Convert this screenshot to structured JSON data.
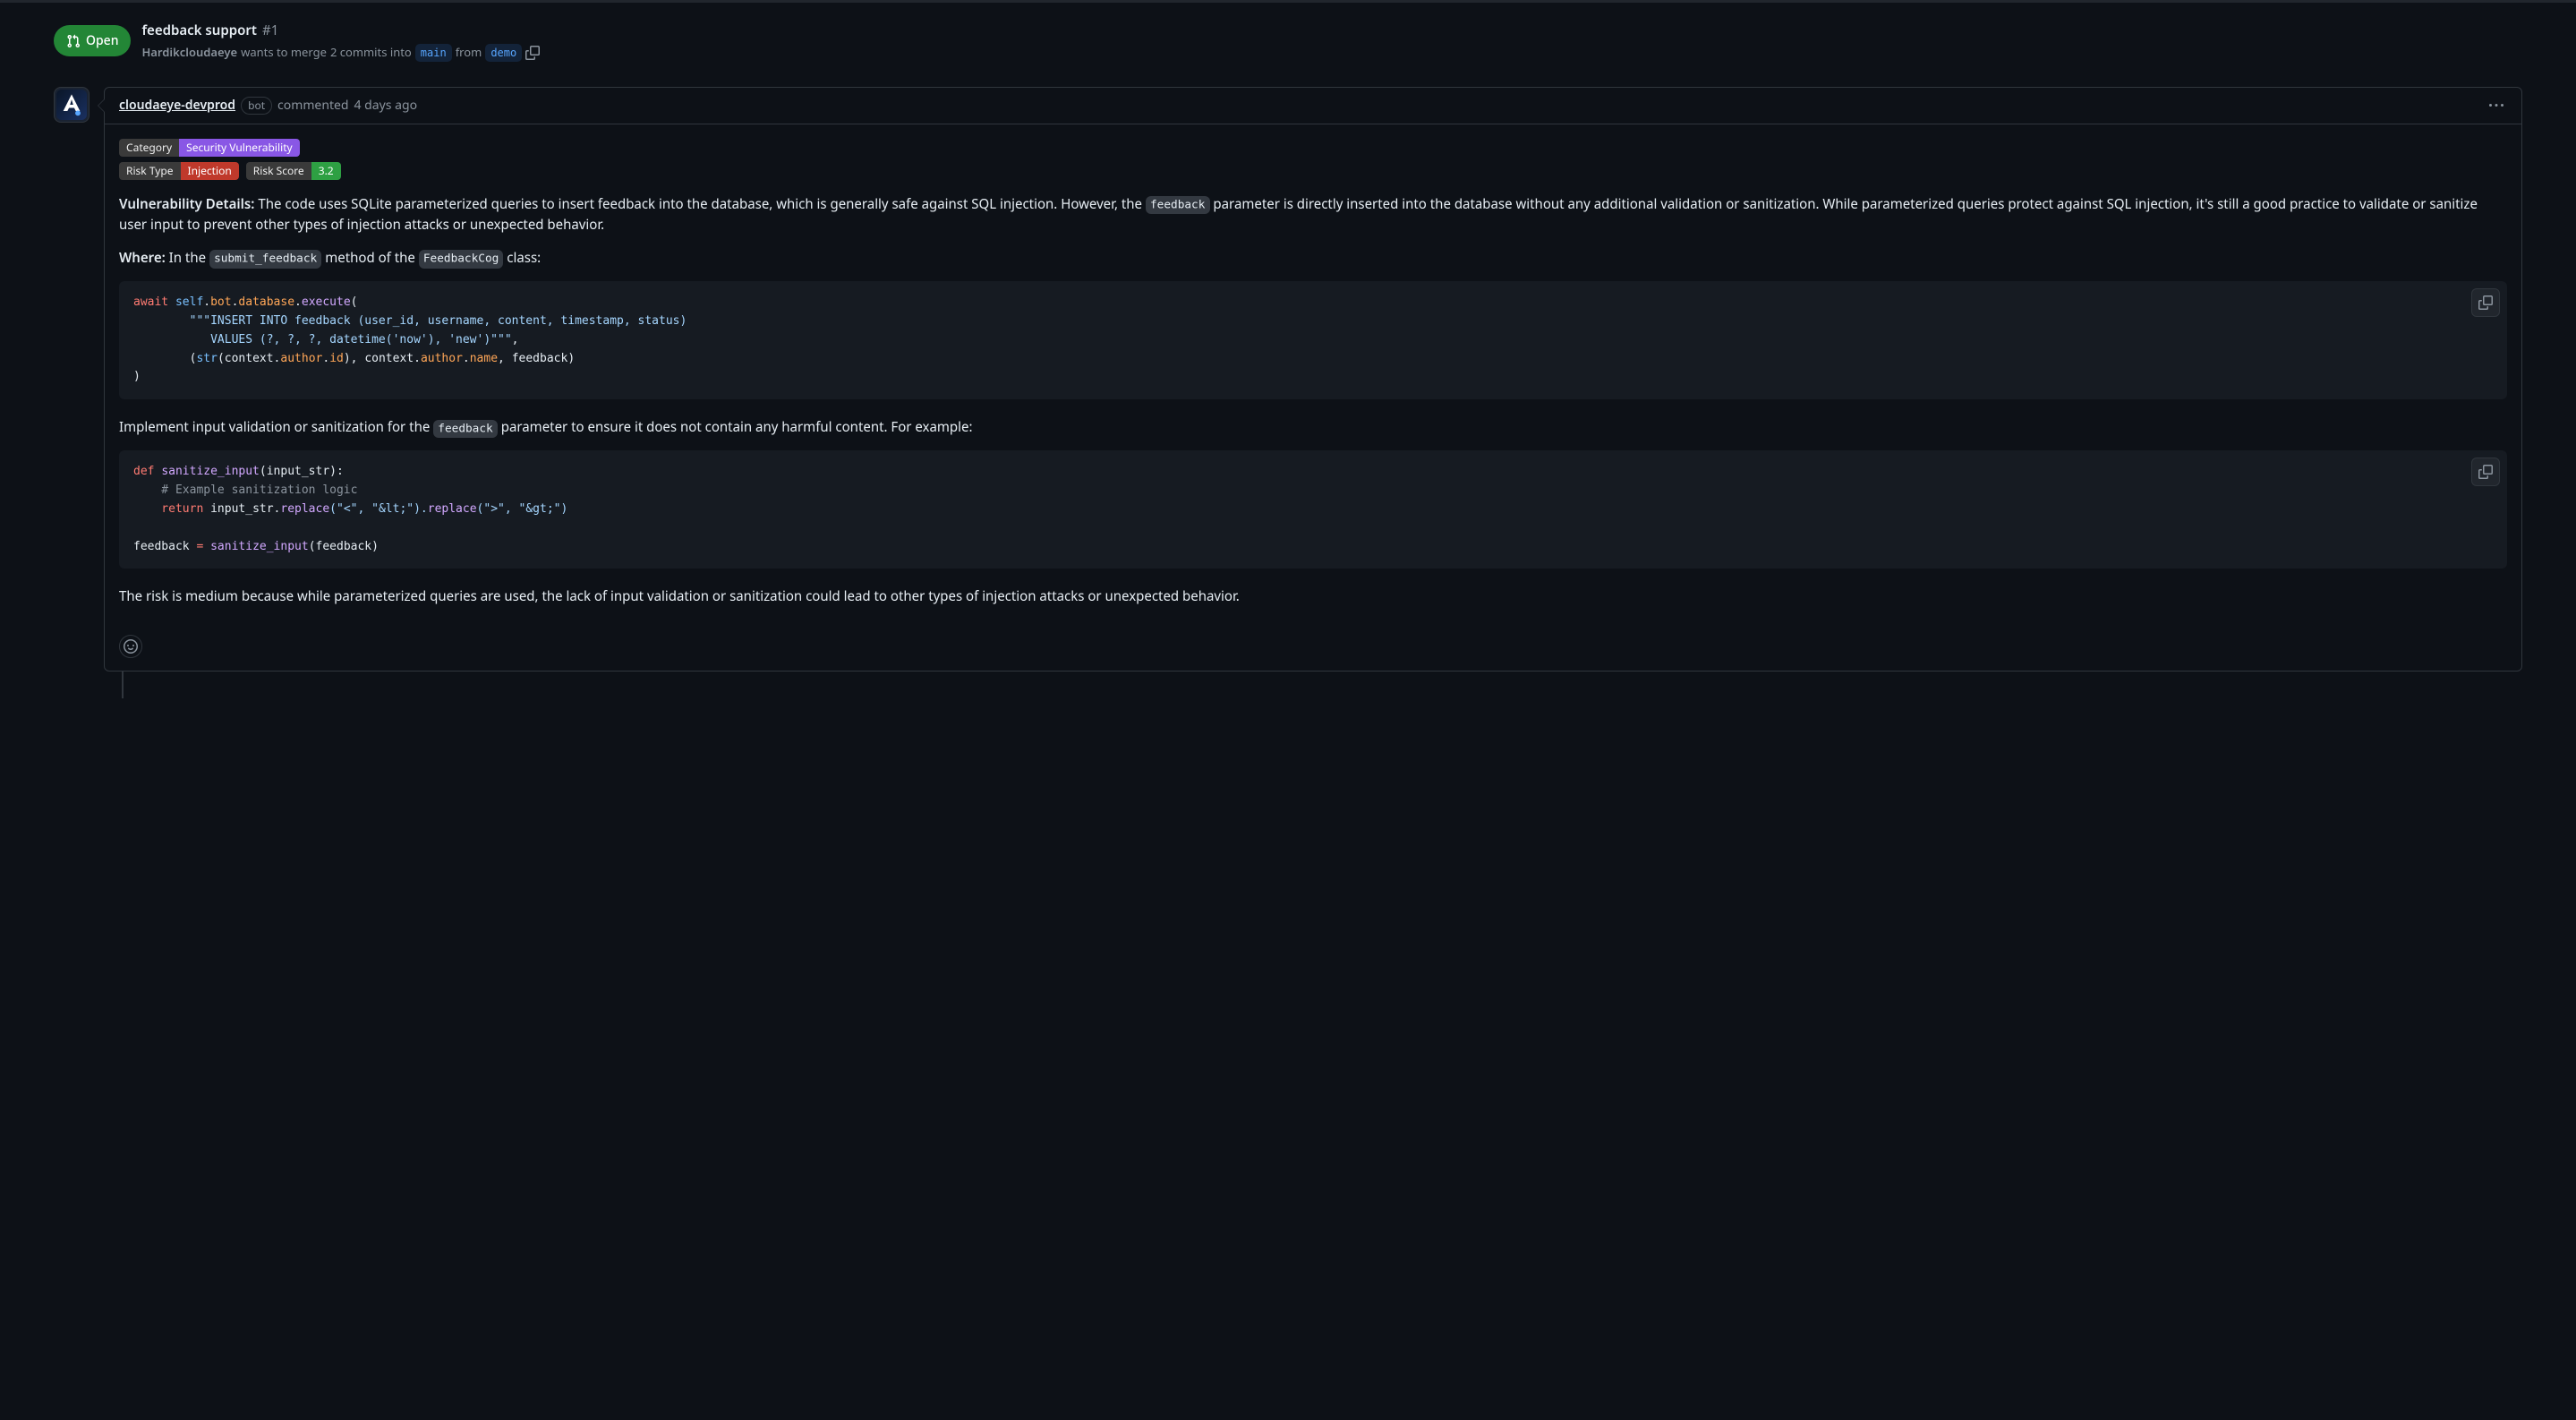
{
  "header": {
    "status": "Open",
    "title": "feedback support",
    "number": "#1",
    "author": "Hardikcloudaeye",
    "merge_text_1": "wants to merge",
    "commits_text": "2 commits into",
    "base_branch": "main",
    "from_text": "from",
    "head_branch": "demo"
  },
  "comment": {
    "author": "cloudaeye-devprod",
    "bot_label": "bot",
    "commented_text": "commented",
    "timestamp": "4 days ago",
    "labels": {
      "category_k": "Category",
      "category_v": "Security Vulnerability",
      "risktype_k": "Risk Type",
      "risktype_v": "Injection",
      "riskscore_k": "Risk Score",
      "riskscore_v": "3.2"
    },
    "p1_strong": "Vulnerability Details:",
    "p1_text_a": " The code uses SQLite parameterized queries to insert feedback into the database, which is generally safe against SQL injection. However, the ",
    "p1_code": "feedback",
    "p1_text_b": " parameter is directly inserted into the database without any additional validation or sanitization. While parameterized queries protect against SQL injection, it's still a good practice to validate or sanitize user input to prevent other types of injection attacks or unexpected behavior.",
    "p2_strong": "Where:",
    "p2_text_a": " In the ",
    "p2_code_a": "submit_feedback",
    "p2_text_b": " method of the ",
    "p2_code_b": "FeedbackCog",
    "p2_text_c": " class:",
    "code1": {
      "kw_await": "await",
      "self": "self",
      "bot": "bot",
      "database": "database",
      "execute": "execute",
      "line2": "        \"\"\"INSERT INTO feedback (user_id, username, content, timestamp, status)",
      "line3": "           VALUES (?, ?, ?, datetime('now'), 'new')\"\"\"",
      "line4": ",",
      "open_p": "        (",
      "kw_str": "str",
      "ctx": "(context.",
      "author": "author",
      "id": "id",
      "mid": "), context.",
      "name": "name",
      "end": ", feedback)",
      "close": ")"
    },
    "p3_text_a": "Implement input validation or sanitization for the ",
    "p3_code": "feedback",
    "p3_text_b": " parameter to ensure it does not contain any harmful content. For example:",
    "code2": {
      "kw_def": "def",
      "fn": "sanitize_input",
      "params": "(input_str):",
      "comment": "    # Example sanitization logic",
      "kw_return": "    return",
      "ret_pre": " input_str.",
      "replace": "replace",
      "args1": "(\"<\", \"&lt;\").",
      "args2": "(\">\", \"&gt;\")",
      "assign_lhs": "feedback ",
      "eq": "=",
      "fn2": " sanitize_input",
      "call": "(feedback)"
    },
    "p4": "The risk is medium because while parameterized queries are used, the lack of input validation or sanitization could lead to other types of injection attacks or unexpected behavior."
  }
}
